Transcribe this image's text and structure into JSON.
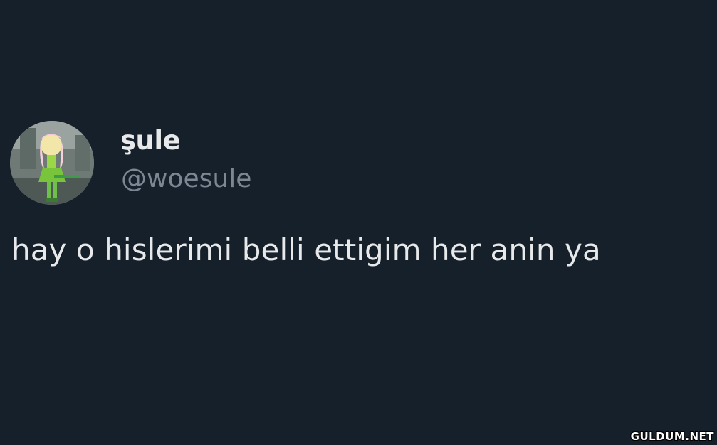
{
  "tweet": {
    "display_name": "şule",
    "handle": "@woesule",
    "text": "hay o hislerimi belli ettigim her anin ya"
  },
  "watermark": {
    "text": "GULDUM.NET"
  },
  "colors": {
    "background": "#16202b",
    "primary_text": "#e7e9ea",
    "secondary_text": "#7b8793"
  }
}
